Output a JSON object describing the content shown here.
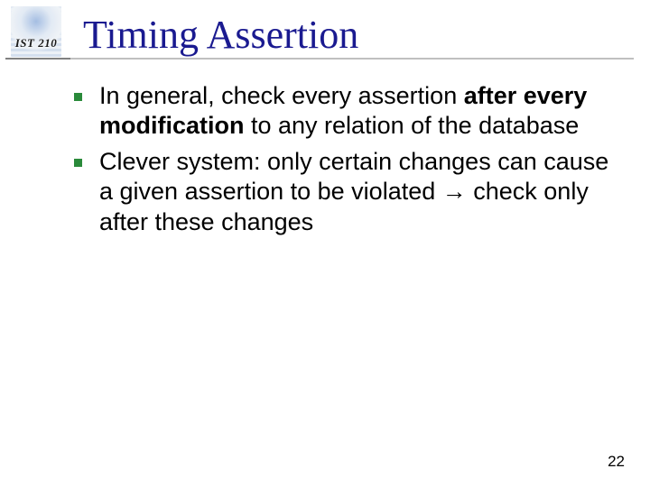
{
  "header": {
    "course_label": "IST 210",
    "title": "Timing Assertion"
  },
  "bullets": [
    {
      "pre": "In general, check every assertion ",
      "bold": "after every modification",
      "post": " to any relation of the database"
    },
    {
      "pre": "Clever system: only certain changes can cause a given assertion to be violated ",
      "arrow": "→",
      "post2": " check only after these changes"
    }
  ],
  "page_number": "22"
}
